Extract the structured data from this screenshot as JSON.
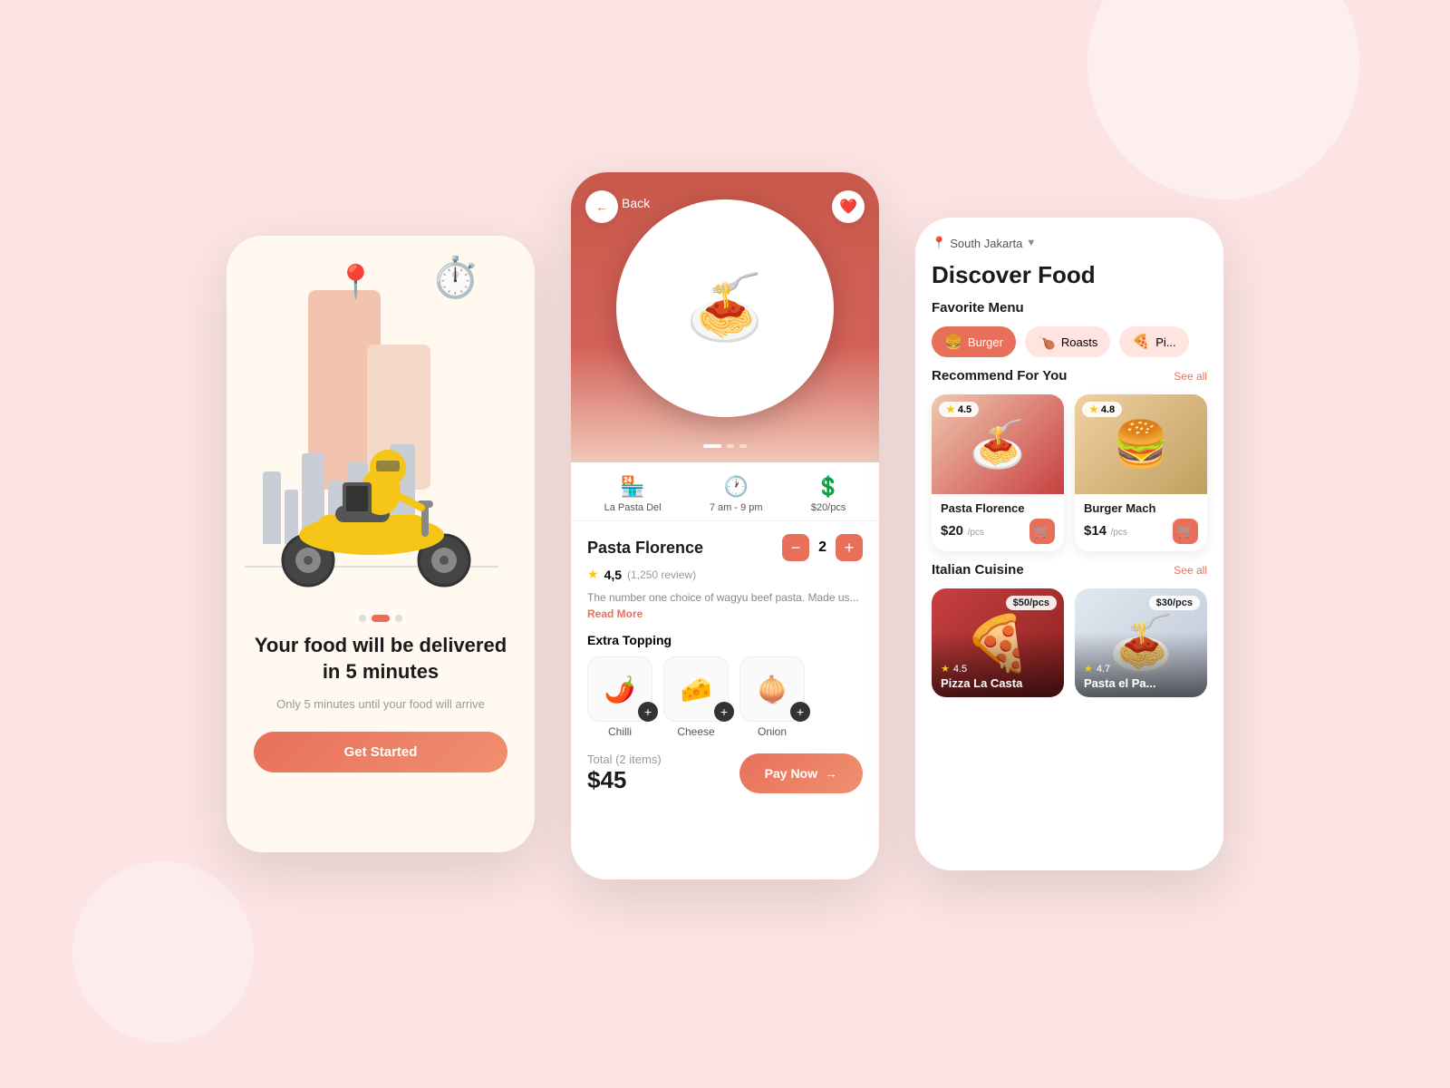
{
  "background": "#fce4e4",
  "phone1": {
    "title": "Your food will be delivered in 5 minutes",
    "subtitle": "Only 5 minutes until your food will arrive",
    "cta": "Get Started",
    "dots": [
      "inactive",
      "active",
      "inactive"
    ]
  },
  "phone2": {
    "back_label": "Back",
    "product_name": "Pasta Florence",
    "rating": "4,5",
    "review_count": "(1,250 review)",
    "description": "The number one choice of wagyu beef pasta. Made us...",
    "read_more": "Read More",
    "store": "La Pasta Del",
    "hours": "7 am - 9 pm",
    "price_per": "$20/pcs",
    "extra_topping_title": "Extra Topping",
    "toppings": [
      {
        "label": "Chilli",
        "emoji": "🌶️"
      },
      {
        "label": "Cheese",
        "emoji": "🧀"
      },
      {
        "label": "Onion",
        "emoji": "🧅"
      }
    ],
    "quantity": 2,
    "total_label": "Total",
    "total_items": "(2 items)",
    "total_amount": "$45",
    "pay_button": "Pay Now"
  },
  "phone3": {
    "location": "South Jakarta",
    "title": "Discover Food",
    "favorite_menu": "Favorite Menu",
    "categories": [
      {
        "label": "Burger",
        "emoji": "🍔",
        "active": true
      },
      {
        "label": "Roasts",
        "emoji": "🍗",
        "active": false
      },
      {
        "label": "Pizza",
        "emoji": "🍕",
        "active": false
      }
    ],
    "recommend_title": "Recommend For You",
    "see_all_1": "See all",
    "food_cards": [
      {
        "name": "Pasta Florence",
        "price": "$20",
        "unit": "/pcs",
        "rating": "4.5",
        "emoji": "🍝",
        "bg": "pasta-bg"
      },
      {
        "name": "Burger Mach",
        "price": "$14",
        "unit": "/pcs",
        "rating": "4.8",
        "emoji": "🍔",
        "bg": "burger-bg"
      }
    ],
    "italian_title": "Italian Cuisine",
    "see_all_2": "See all",
    "italian_cards": [
      {
        "name": "Pizza La Casta",
        "price": "$50/pcs",
        "rating": "4.5",
        "emoji": "🍕",
        "bg": "pizza-bg"
      },
      {
        "name": "Pasta el Pa...",
        "price": "$30/pcs",
        "rating": "4.7",
        "emoji": "🍝",
        "bg": "pasta2-bg"
      }
    ]
  }
}
